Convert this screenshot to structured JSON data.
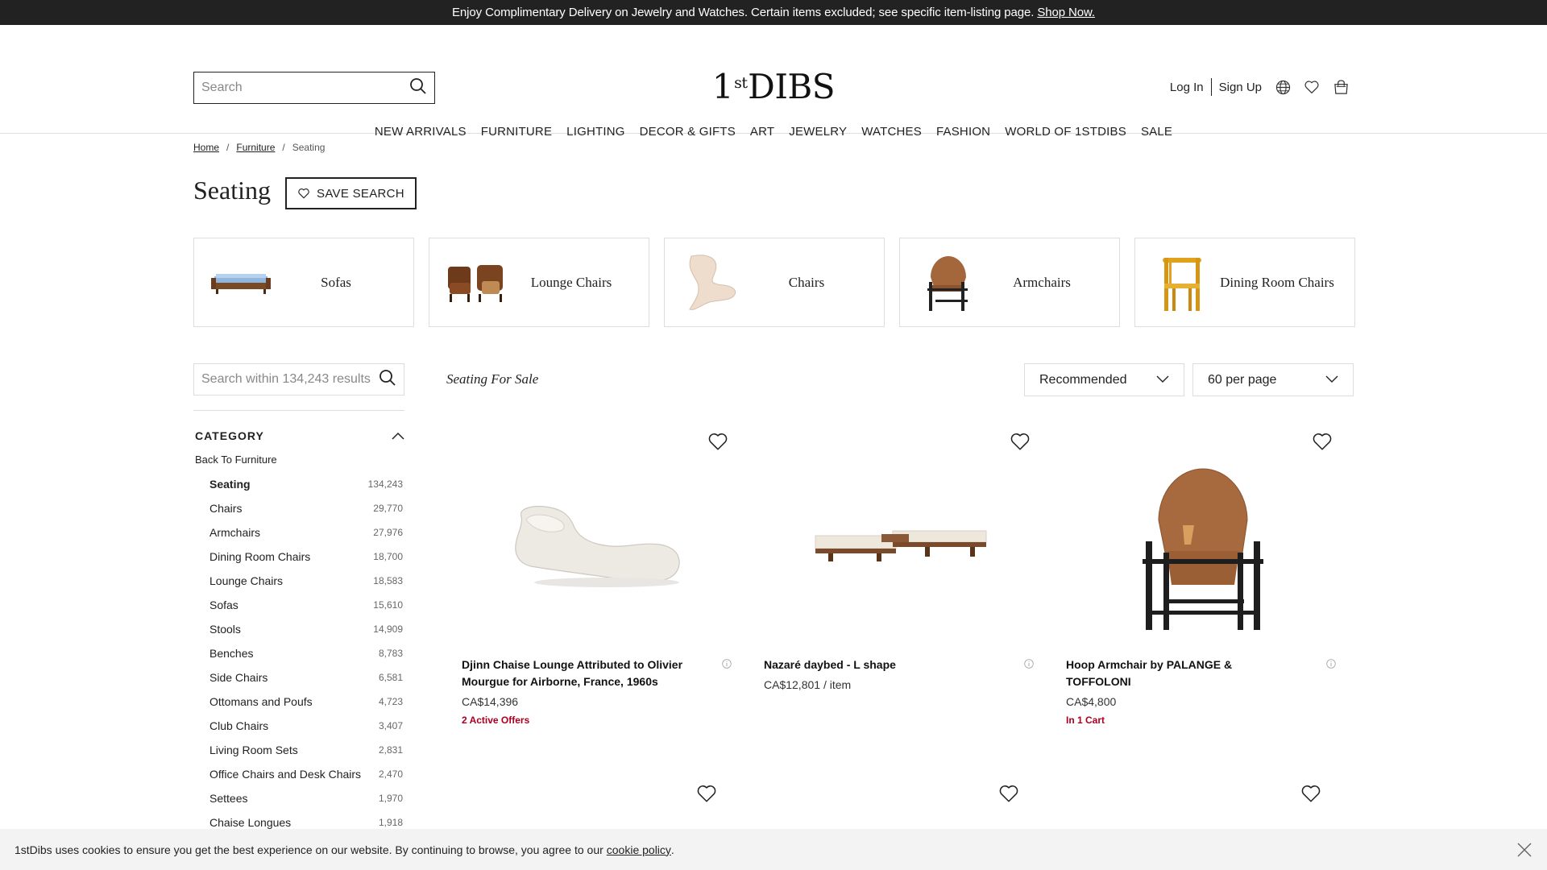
{
  "promo": {
    "text": "Enjoy Complimentary Delivery on Jewelry and Watches. Certain items excluded; see specific item-listing page.",
    "link": "Shop Now."
  },
  "header": {
    "search_placeholder": "Search",
    "logo_pre": "1",
    "logo_sup": "st",
    "logo_post": "DIBS",
    "login": "Log In",
    "signup": "Sign Up"
  },
  "nav": [
    "NEW ARRIVALS",
    "FURNITURE",
    "LIGHTING",
    "DECOR & GIFTS",
    "ART",
    "JEWELRY",
    "WATCHES",
    "FASHION",
    "WORLD OF 1STDIBS",
    "SALE"
  ],
  "breadcrumb": {
    "home": "Home",
    "furniture": "Furniture",
    "current": "Seating",
    "sep": "/"
  },
  "page": {
    "title": "Seating",
    "save_search": "SAVE SEARCH"
  },
  "tiles": [
    "Sofas",
    "Lounge Chairs",
    "Chairs",
    "Armchairs",
    "Dining Room Chairs"
  ],
  "sidebar": {
    "search_placeholder": "Search within 134,243 results",
    "category_heading": "CATEGORY",
    "back_link": "Back To Furniture",
    "categories": [
      {
        "name": "Seating",
        "count": "134,243"
      },
      {
        "name": "Chairs",
        "count": "29,770"
      },
      {
        "name": "Armchairs",
        "count": "27,976"
      },
      {
        "name": "Dining Room Chairs",
        "count": "18,700"
      },
      {
        "name": "Lounge Chairs",
        "count": "18,583"
      },
      {
        "name": "Sofas",
        "count": "15,610"
      },
      {
        "name": "Stools",
        "count": "14,909"
      },
      {
        "name": "Benches",
        "count": "8,783"
      },
      {
        "name": "Side Chairs",
        "count": "6,581"
      },
      {
        "name": "Ottomans and Poufs",
        "count": "4,723"
      },
      {
        "name": "Club Chairs",
        "count": "3,407"
      },
      {
        "name": "Living Room Sets",
        "count": "2,831"
      },
      {
        "name": "Office Chairs and Desk Chairs",
        "count": "2,470"
      },
      {
        "name": "Settees",
        "count": "1,970"
      },
      {
        "name": "Chaise Longues",
        "count": "1,918"
      }
    ]
  },
  "results": {
    "title": "Seating For Sale",
    "sort": "Recommended",
    "per_page": "60 per page"
  },
  "products": [
    {
      "title": "Djinn Chaise Lounge Attributed to Olivier Mourgue for Airborne, France, 1960s",
      "price": "CA$14,396",
      "badge": "2 Active Offers"
    },
    {
      "title": "Nazaré daybed - L shape",
      "price": "CA$12,801 / item",
      "badge": ""
    },
    {
      "title": "Hoop Armchair by PALANGE & TOFFOLONI",
      "price": "CA$4,800",
      "badge": "In 1 Cart"
    }
  ],
  "cookie": {
    "text": "1stDibs uses cookies to ensure you get the best experience on our website. By continuing to browse, you agree to our",
    "link": "cookie policy",
    "end": "."
  },
  "colors": {
    "promo_bg": "#222222",
    "badge_red": "#a8001e",
    "cookie_bg": "#f3f3f3"
  }
}
